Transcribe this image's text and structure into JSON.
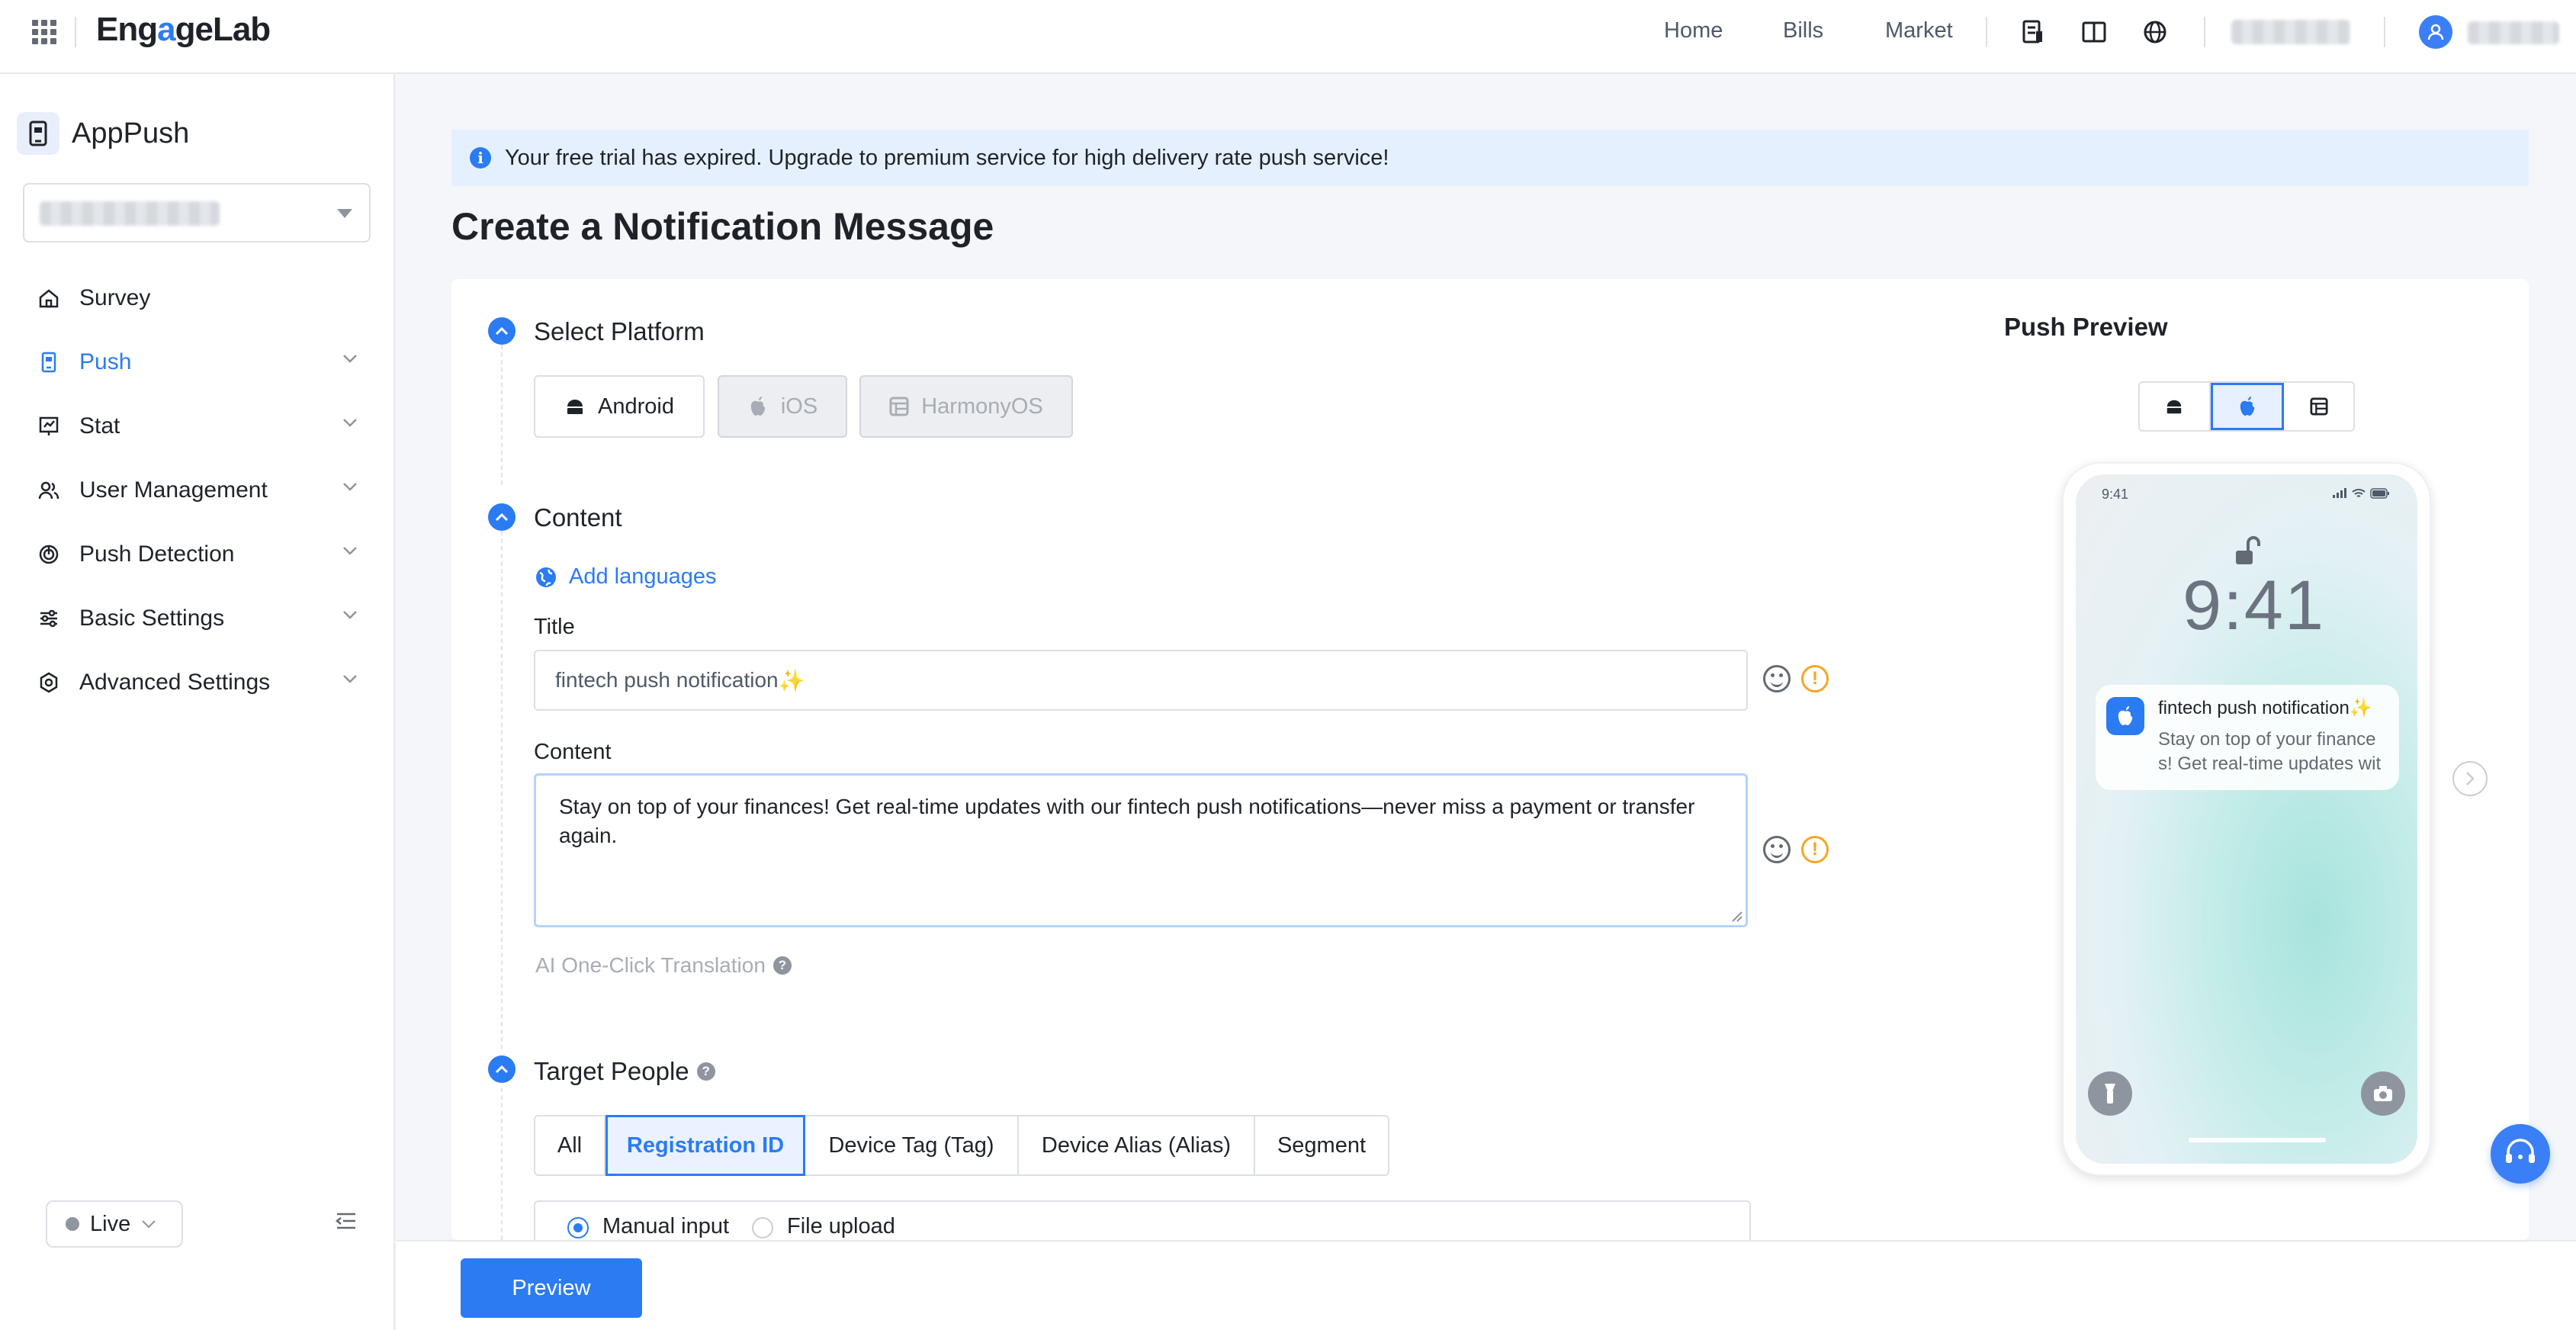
{
  "topbar": {
    "logo_pre": "Eng",
    "logo_g": "a",
    "logo_post": "geLab",
    "nav": [
      "Home",
      "Bills",
      "Market"
    ],
    "icons": [
      "document-icon",
      "columns-icon",
      "globe-icon"
    ]
  },
  "sidebar": {
    "app_name": "AppPush",
    "items": [
      {
        "label": "Survey",
        "icon": "home-icon",
        "has_chevron": false
      },
      {
        "label": "Push",
        "icon": "push-icon",
        "has_chevron": true,
        "active": true
      },
      {
        "label": "Stat",
        "icon": "chart-icon",
        "has_chevron": true
      },
      {
        "label": "User Management",
        "icon": "users-icon",
        "has_chevron": true
      },
      {
        "label": "Push Detection",
        "icon": "detection-icon",
        "has_chevron": true
      },
      {
        "label": "Basic Settings",
        "icon": "sliders-icon",
        "has_chevron": true
      },
      {
        "label": "Advanced Settings",
        "icon": "gear-icon",
        "has_chevron": true
      }
    ],
    "environment": "Live"
  },
  "banner": {
    "text": "Your free trial has expired. Upgrade to premium service for high delivery rate push service!"
  },
  "page_title": "Create a Notification Message",
  "select_platform": {
    "title": "Select Platform",
    "platforms": [
      {
        "label": "Android",
        "enabled": true
      },
      {
        "label": "iOS",
        "enabled": false
      },
      {
        "label": "HarmonyOS",
        "enabled": false
      }
    ]
  },
  "content": {
    "title": "Content",
    "add_languages": "Add languages",
    "title_label": "Title",
    "title_value": "fintech push notification",
    "title_emoji": "✨",
    "content_label": "Content",
    "content_value": "Stay on top of your finances! Get real-time updates with our fintech push notifications—never miss a payment or transfer again.",
    "ai_translation": "AI One-Click Translation"
  },
  "target": {
    "title": "Target People",
    "tabs": [
      "All",
      "Registration ID",
      "Device Tag (Tag)",
      "Device Alias (Alias)",
      "Segment"
    ],
    "active_tab": "Registration ID",
    "input_modes": [
      "Manual input",
      "File upload"
    ],
    "selected_mode": "Manual input"
  },
  "preview": {
    "title": "Push Preview",
    "status_time": "9:41",
    "lock_time": "9:41",
    "notif_title": "fintech push notification✨",
    "notif_body": "Stay on top of your finances! Get real-time updates with our fintech push notifications—never miss a payment or transfer again.",
    "selected_platform": "ios"
  },
  "footer": {
    "preview_button": "Preview"
  },
  "colors": {
    "accent": "#2b7bf3",
    "banner_bg": "#e5f0ff",
    "warning": "#f5a623"
  }
}
